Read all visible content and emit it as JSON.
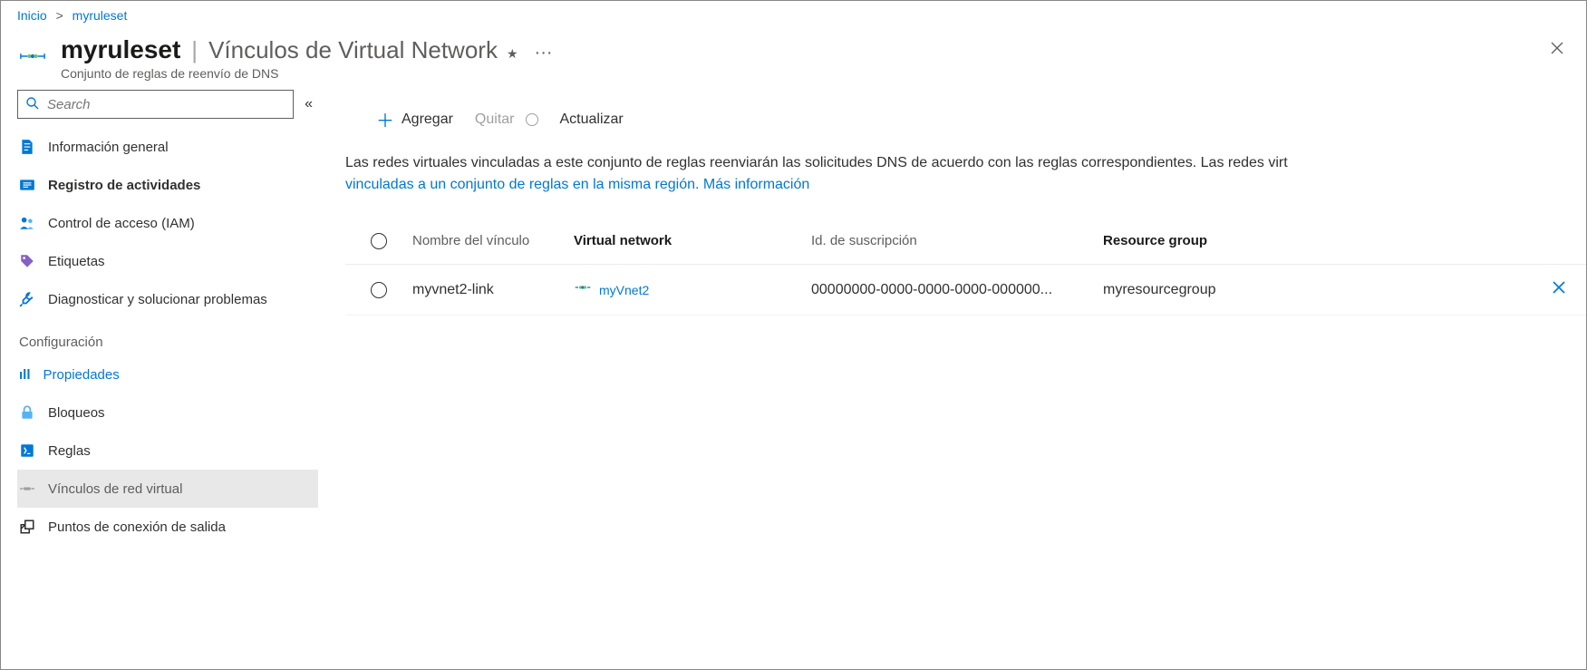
{
  "breadcrumb": {
    "home": "Inicio",
    "current": "myruleset"
  },
  "header": {
    "title": "myruleset",
    "section": "Vínculos de Virtual Network",
    "subtitle": "Conjunto de reglas de reenvío de DNS",
    "ellipsis": "···"
  },
  "search": {
    "placeholder": "Search"
  },
  "nav": {
    "items": [
      {
        "label": "Información general"
      },
      {
        "label": "Registro de actividades"
      },
      {
        "label": "Control de acceso (IAM)"
      },
      {
        "label": "Etiquetas"
      },
      {
        "label": "Diagnosticar y solucionar problemas"
      }
    ],
    "section_label": "Configuración",
    "settings": [
      {
        "label": "Propiedades",
        "highlighted": true,
        "prefix": "ıll"
      },
      {
        "label": "Bloqueos"
      },
      {
        "label": "Reglas"
      },
      {
        "label": "Vínculos de red virtual",
        "selected": true
      },
      {
        "label": "Puntos de conexión de salida"
      }
    ]
  },
  "toolbar": {
    "add": "Agregar",
    "remove": "Quitar",
    "refresh": "Actualizar"
  },
  "description": {
    "text1": "Las redes virtuales vinculadas a este conjunto de reglas reenviarán las solicitudes DNS de acuerdo con las reglas correspondientes.  Las redes virt",
    "link": "vinculadas a un conjunto de reglas en la misma región. Más información"
  },
  "table": {
    "headers": {
      "link_name": "Nombre del vínculo",
      "vnet": "Virtual network",
      "subscription": "Id. de suscripción",
      "resource_group": "Resource group"
    },
    "rows": [
      {
        "link_name": "myvnet2-link",
        "vnet": "myVnet2",
        "subscription": "00000000-0000-0000-0000-000000...",
        "resource_group": "myresourcegroup"
      }
    ]
  }
}
